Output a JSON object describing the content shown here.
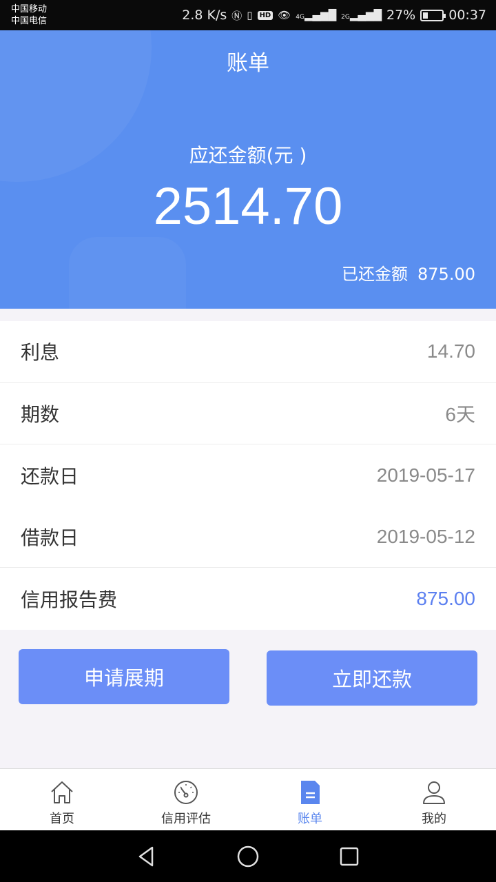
{
  "status_bar": {
    "carrier1": "中国移动",
    "carrier2": "中国电信",
    "speed": "2.8 K/s",
    "network1": "4G",
    "network2": "2G",
    "hd": "HD",
    "battery_percent": "27%",
    "battery_level": 0.27,
    "time": "00:37"
  },
  "header": {
    "title": "账单",
    "due_label": "应还金额(元 )",
    "due_amount": "2514.70",
    "repaid_label": "已还金额",
    "repaid_amount": "875.00"
  },
  "details": [
    {
      "label": "利息",
      "value": "14.70"
    },
    {
      "label": "期数",
      "value": "6天"
    },
    {
      "label": "还款日",
      "value": "2019-05-17"
    },
    {
      "label": "借款日",
      "value": "2019-05-12"
    },
    {
      "label": "信用报告费",
      "value": "875.00"
    }
  ],
  "actions": {
    "extend": "申请展期",
    "repay": "立即还款"
  },
  "tabs": [
    {
      "label": "首页",
      "icon": "home-icon"
    },
    {
      "label": "信用评估",
      "icon": "gauge-icon"
    },
    {
      "label": "账单",
      "icon": "bill-icon",
      "active": true
    },
    {
      "label": "我的",
      "icon": "user-icon"
    }
  ],
  "colors": {
    "header_bg": "#5a8ff0",
    "button": "#6b8ef7",
    "accent_text": "#5b7ff0",
    "active_tab": "#5a86ee"
  }
}
